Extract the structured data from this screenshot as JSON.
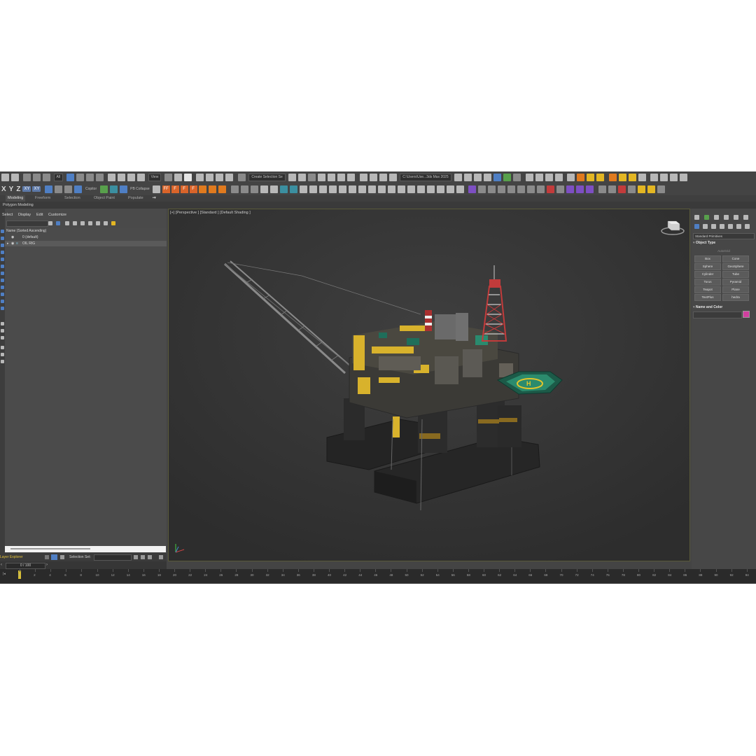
{
  "toolbar_row1": {
    "selection_filter": "All",
    "view_dropdown": "View",
    "named_selection": "Create Selection Se",
    "project_path": "C:\\Users\\Use...3ds Max 2025"
  },
  "toolbar_row2": {
    "axis_x": "X",
    "axis_y": "Y",
    "axis_z": "Z",
    "axis_xy": "XY",
    "axis_xy2": "XY",
    "copitor_label": "Copitor",
    "pb_collapse_label": "PB Collapse",
    "f_buttons": [
      "FF",
      "F",
      "F",
      "F"
    ]
  },
  "ribbon": {
    "tabs": [
      "Modeling",
      "Freeform",
      "Selection",
      "Object Paint",
      "Populate"
    ],
    "active_tab": "Modeling",
    "panel_label": "Polygon Modeling"
  },
  "scene_explorer": {
    "menu": [
      "Select",
      "Display",
      "Edit",
      "Customize"
    ],
    "column_header": "Name (Sorted Ascending)",
    "rows": [
      "0 (default)",
      "OIL RIG"
    ]
  },
  "layer_bar": {
    "label": "Layer Explorer",
    "selection_set_label": "Selection Set:"
  },
  "frame_counter": "0 / 100",
  "viewport": {
    "label": "[+] [Perspective ] [Standard ] [Default Shading ]",
    "heli_mark": "H"
  },
  "command_panel": {
    "category": "Standard Primitives",
    "object_type_title": "Object Type",
    "autogrid": "AutoGrid",
    "primitives": [
      "Box",
      "Cone",
      "Sphere",
      "GeoSphere",
      "Cylinder",
      "Tube",
      "Torus",
      "Pyramid",
      "Teapot",
      "Plane",
      "TextPlus",
      "hedra"
    ],
    "name_and_color_title": "Name and Color",
    "object_color": "#d13fa0"
  },
  "timeline": {
    "ticks": [
      "0",
      "2",
      "4",
      "6",
      "8",
      "10",
      "12",
      "14",
      "16",
      "18",
      "20",
      "22",
      "24",
      "26",
      "28",
      "30",
      "32",
      "34",
      "36",
      "38",
      "40",
      "42",
      "44",
      "46",
      "48",
      "50",
      "52",
      "54",
      "56",
      "58",
      "60",
      "62",
      "64",
      "66",
      "68",
      "70",
      "72",
      "74",
      "76",
      "78",
      "80",
      "82",
      "84",
      "86",
      "88",
      "90",
      "92",
      "94"
    ]
  }
}
